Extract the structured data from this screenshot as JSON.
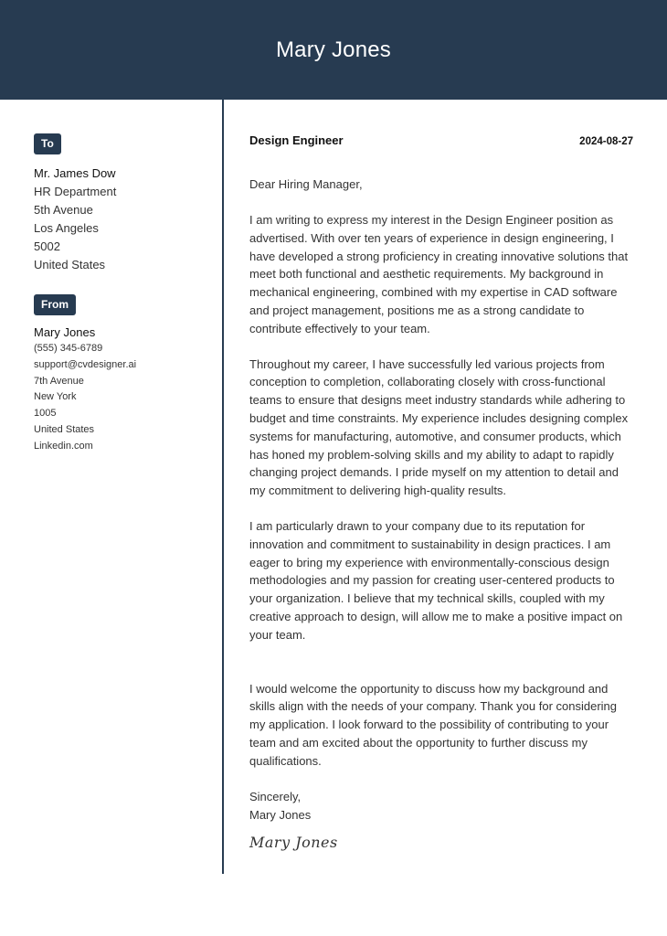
{
  "header": {
    "name": "Mary Jones"
  },
  "colors": {
    "accent": "#273b51",
    "text": "#333333"
  },
  "recipient": {
    "badge": "To",
    "name": "Mr. James Dow",
    "lines": [
      "HR Department",
      "5th Avenue",
      "Los Angeles",
      "5002",
      "United States"
    ]
  },
  "sender": {
    "badge": "From",
    "name": "Mary Jones",
    "lines": [
      "(555) 345-6789",
      "support@cvdesigner.ai",
      "7th Avenue",
      "New York",
      "1005",
      "United States",
      "Linkedin.com"
    ]
  },
  "letter": {
    "role": "Design Engineer",
    "date": "2024-08-27",
    "salutation": "Dear Hiring Manager,",
    "paragraphs": [
      "I am writing to express my interest in the Design Engineer position as advertised. With over ten years of experience in design engineering, I have developed a strong proficiency in creating innovative solutions that meet both functional and aesthetic requirements. My background in mechanical engineering, combined with my expertise in CAD software and project management, positions me as a strong candidate to contribute effectively to your team.",
      "Throughout my career, I have successfully led various projects from conception to completion, collaborating closely with cross-functional teams to ensure that designs meet industry standards while adhering to budget and time constraints. My experience includes designing complex systems for manufacturing, automotive, and consumer products, which has honed my problem-solving skills and my ability to adapt to rapidly changing project demands. I pride myself on my attention to detail and my commitment to delivering high-quality results.",
      "I am particularly drawn to your company due to its reputation for innovation and commitment to sustainability in design practices. I am eager to bring my experience with environmentally-conscious design methodologies and my passion for creating user-centered products to your organization. I believe that my technical skills, coupled with my creative approach to design, will allow me to make a positive impact on your team.",
      "I would welcome the opportunity to discuss how my background and skills align with the needs of your company. Thank you for considering my application. I look forward to the possibility of contributing to your team and am excited about the opportunity to further discuss my qualifications."
    ],
    "closing": "Sincerely,",
    "signoff_name": "Mary Jones",
    "signature": "Mary Jones"
  }
}
